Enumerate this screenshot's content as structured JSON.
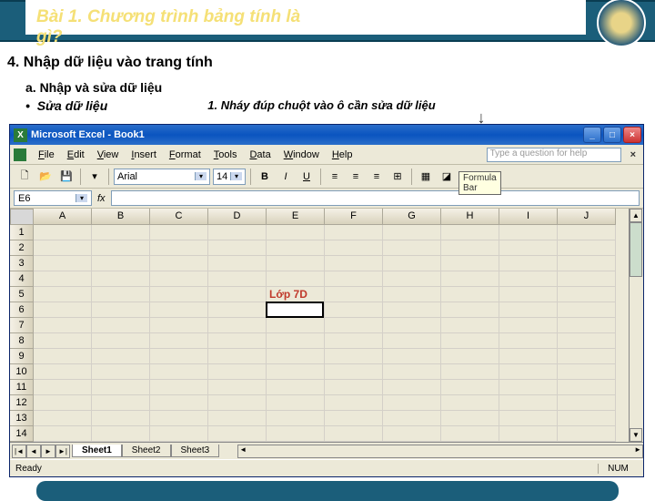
{
  "slide": {
    "title": "Bài 1. Chương trình bảng tính là gì?",
    "section": "4. Nhập dữ liệu vào trang tính",
    "subsection": "a. Nhập và sửa dữ liệu",
    "bullet": "Sửa dữ liệu",
    "instruction": "1. Nháy đúp chuột vào ô cần sửa dữ liệu"
  },
  "excel": {
    "app_title": "Microsoft Excel - Book1",
    "menus": [
      "File",
      "Edit",
      "View",
      "Insert",
      "Format",
      "Tools",
      "Data",
      "Window",
      "Help"
    ],
    "ask_placeholder": "Type a question for help",
    "font": "Arial",
    "font_size": "14",
    "name_box": "E6",
    "formula_label": "Formula Bar",
    "columns": [
      "A",
      "B",
      "C",
      "D",
      "E",
      "F",
      "G",
      "H",
      "I",
      "J"
    ],
    "rows": [
      "1",
      "2",
      "3",
      "4",
      "5",
      "6",
      "7",
      "8",
      "9",
      "10",
      "11",
      "12",
      "13",
      "14"
    ],
    "active_cell": {
      "row": 6,
      "col": "E",
      "value": "Lớp 7D"
    },
    "sheet_tabs": [
      "Sheet1",
      "Sheet2",
      "Sheet3"
    ],
    "active_sheet": 0,
    "status": "Ready",
    "num_indicator": "NUM",
    "window_buttons": {
      "min": "_",
      "max": "□",
      "close": "×"
    }
  }
}
